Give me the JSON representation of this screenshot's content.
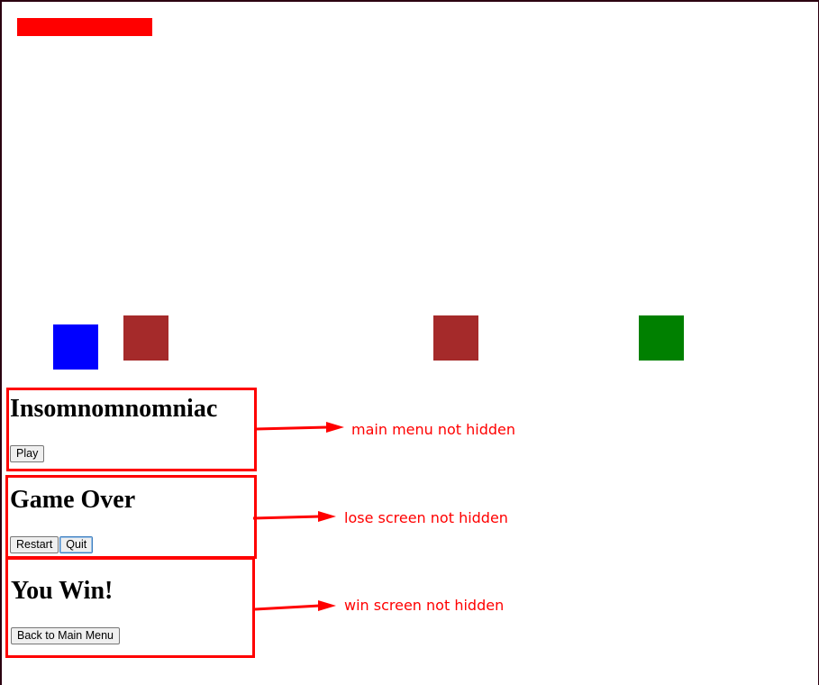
{
  "colors": {
    "health_bar": "#ff0000",
    "player": "#0000ff",
    "enemy": "#a52a2a",
    "goal": "#008000",
    "annotation": "#ff0000"
  },
  "game": {
    "health_bar_fill": 1.0,
    "tiles": [
      {
        "kind": "player",
        "color": "blue"
      },
      {
        "kind": "enemy",
        "color": "brown"
      },
      {
        "kind": "enemy",
        "color": "brown"
      },
      {
        "kind": "goal",
        "color": "green"
      }
    ]
  },
  "main_menu": {
    "title": "Insomnomnomniac",
    "play_label": "Play"
  },
  "lose_screen": {
    "title": "Game Over",
    "restart_label": "Restart",
    "quit_label": "Quit"
  },
  "win_screen": {
    "title": "You Win!",
    "back_label": "Back to Main Menu"
  },
  "annotations": {
    "main": "main menu not hidden",
    "lose": "lose screen not hidden",
    "win": "win screen not hidden"
  }
}
